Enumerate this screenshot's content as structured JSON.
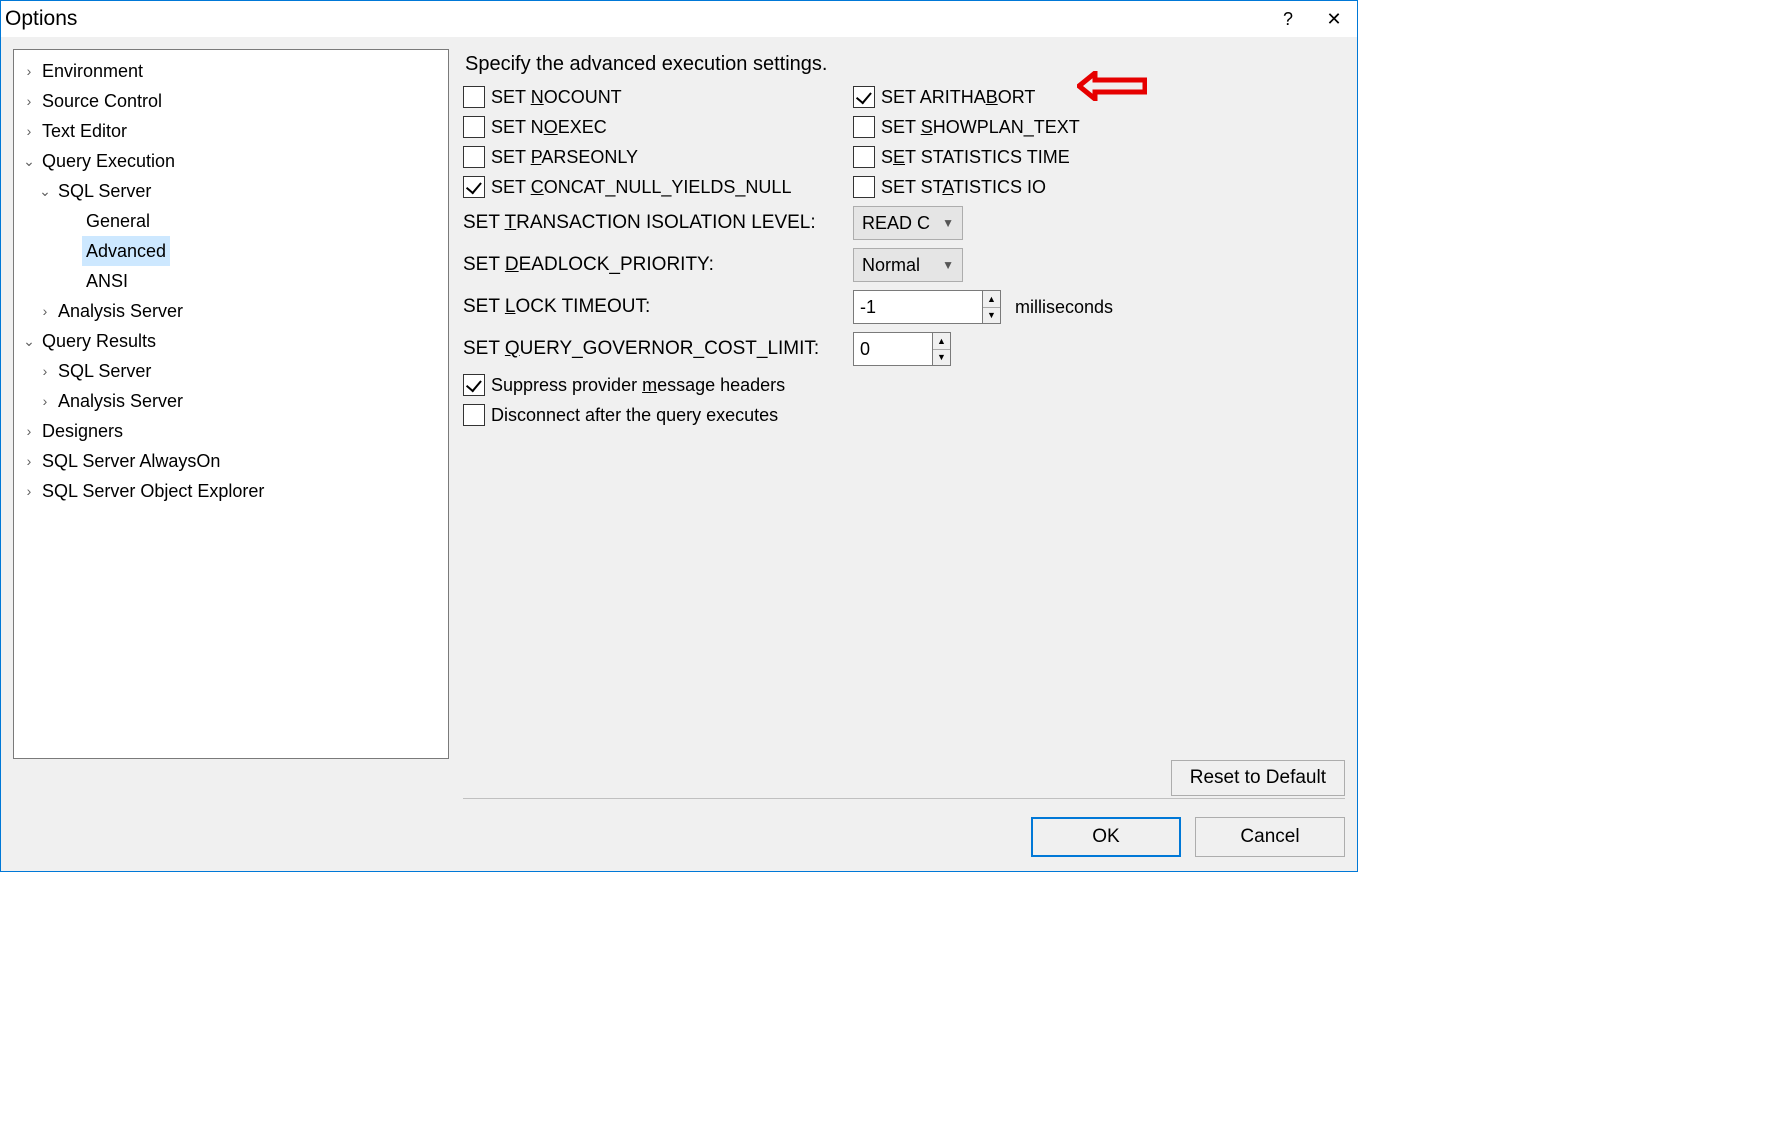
{
  "window": {
    "title": "Options",
    "help": "?",
    "close": "✕"
  },
  "tree": [
    {
      "label": "Environment",
      "level": 0,
      "caret": "›"
    },
    {
      "label": "Source Control",
      "level": 0,
      "caret": "›"
    },
    {
      "label": "Text Editor",
      "level": 0,
      "caret": "›"
    },
    {
      "label": "Query Execution",
      "level": 0,
      "caret": "⌄"
    },
    {
      "label": "SQL Server",
      "level": 1,
      "caret": "⌄"
    },
    {
      "label": "General",
      "level": 2,
      "caret": ""
    },
    {
      "label": "Advanced",
      "level": 2,
      "caret": "",
      "selected": true
    },
    {
      "label": "ANSI",
      "level": 2,
      "caret": ""
    },
    {
      "label": "Analysis Server",
      "level": 1,
      "caret": "›"
    },
    {
      "label": "Query Results",
      "level": 0,
      "caret": "⌄"
    },
    {
      "label": "SQL Server",
      "level": 1,
      "caret": "›"
    },
    {
      "label": "Analysis Server",
      "level": 1,
      "caret": "›"
    },
    {
      "label": "Designers",
      "level": 0,
      "caret": "›"
    },
    {
      "label": "SQL Server AlwaysOn",
      "level": 0,
      "caret": "›"
    },
    {
      "label": "SQL Server Object Explorer",
      "level": 0,
      "caret": "›"
    }
  ],
  "panel": {
    "heading": "Specify the advanced execution settings.",
    "checks": {
      "nocount": {
        "pre": "SET ",
        "u": "N",
        "post": "OCOUNT",
        "checked": false
      },
      "arithabort": {
        "pre": "SET ARITHA",
        "u": "B",
        "post": "ORT",
        "checked": true
      },
      "noexec": {
        "pre": "SET N",
        "u": "O",
        "post": "EXEC",
        "checked": false
      },
      "showplan": {
        "pre": "SET ",
        "u": "S",
        "post": "HOWPLAN_TEXT",
        "checked": false
      },
      "parseonly": {
        "pre": "SET ",
        "u": "P",
        "post": "ARSEONLY",
        "checked": false
      },
      "stattime": {
        "pre": "S",
        "u": "E",
        "post": "T STATISTICS TIME",
        "checked": false
      },
      "concat": {
        "pre": "SET ",
        "u": "C",
        "post": "ONCAT_NULL_YIELDS_NULL",
        "checked": true
      },
      "statio": {
        "pre": "SET ST",
        "u": "A",
        "post": "TISTICS IO",
        "checked": false
      }
    },
    "tiso": {
      "pre": "SET ",
      "u": "T",
      "post": "RANSACTION ISOLATION LEVEL:",
      "value": "READ C"
    },
    "deadlock": {
      "pre": "SET ",
      "u": "D",
      "post": "EADLOCK_PRIORITY:",
      "value": "Normal"
    },
    "locktimeout": {
      "pre": "SET ",
      "u": "L",
      "post": "OCK TIMEOUT:",
      "value": "-1",
      "suffix": "milliseconds"
    },
    "querygov": {
      "pre": "SET ",
      "u": "Q",
      "post": "UERY_GOVERNOR_COST_LIMIT:",
      "value": "0"
    },
    "suppress": {
      "pre": "Suppress provider ",
      "u": "m",
      "post": "essage headers",
      "checked": true
    },
    "disconnect": {
      "pre": "Disconnect after the query executes",
      "u": "",
      "post": "",
      "checked": false
    },
    "reset": {
      "pre": "",
      "u": "R",
      "post": "eset to Default"
    }
  },
  "footer": {
    "ok": "OK",
    "cancel": "Cancel"
  }
}
